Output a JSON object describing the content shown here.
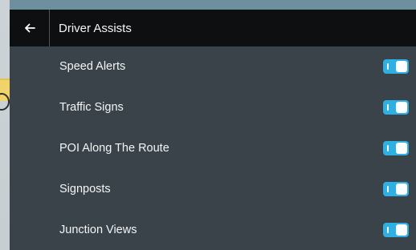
{
  "header": {
    "title": "Driver Assists",
    "back_icon": "arrow-left-icon"
  },
  "settings": [
    {
      "label": "Speed Alerts",
      "enabled": true
    },
    {
      "label": "Traffic Signs",
      "enabled": true
    },
    {
      "label": "POI Along The Route",
      "enabled": true
    },
    {
      "label": "Signposts",
      "enabled": true
    },
    {
      "label": "Junction Views",
      "enabled": true
    }
  ],
  "colors": {
    "header_bg": "#0e0f10",
    "panel_bg": "#3a4349",
    "accent": "#2fb0e2",
    "text": "#f3f5f6"
  }
}
